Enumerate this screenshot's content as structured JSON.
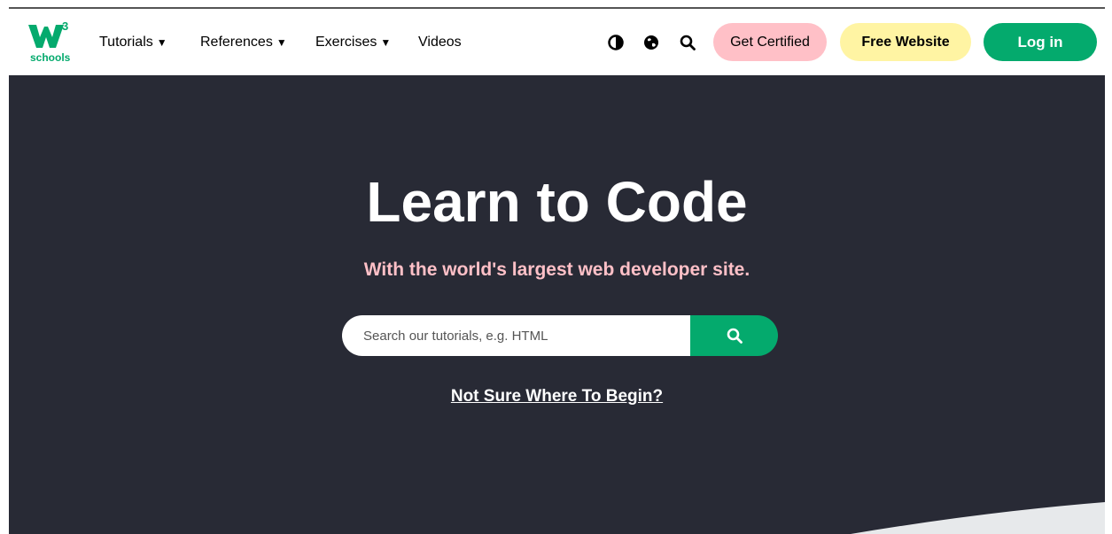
{
  "logo": {
    "superscript": "3",
    "wordmark": "schools",
    "brand_color": "#04AA6D"
  },
  "nav": {
    "tutorials": "Tutorials",
    "references": "References",
    "exercises": "Exercises",
    "videos": "Videos",
    "caret": "▼"
  },
  "icons": [
    "contrast-icon",
    "globe-icon",
    "search-icon"
  ],
  "buttons": {
    "get_certified": "Get Certified",
    "free_website": "Free Website",
    "login": "Log in"
  },
  "hero": {
    "title": "Learn to Code",
    "tagline": "With the world's largest web developer site.",
    "search_placeholder": "Search our tutorials, e.g. HTML",
    "begin_link": "Not Sure Where To Begin?"
  },
  "colors": {
    "hero_bg": "#282A35",
    "accent_green": "#04AA6D",
    "pink": "#FFC0C7",
    "yellow": "#FFF4A3"
  }
}
